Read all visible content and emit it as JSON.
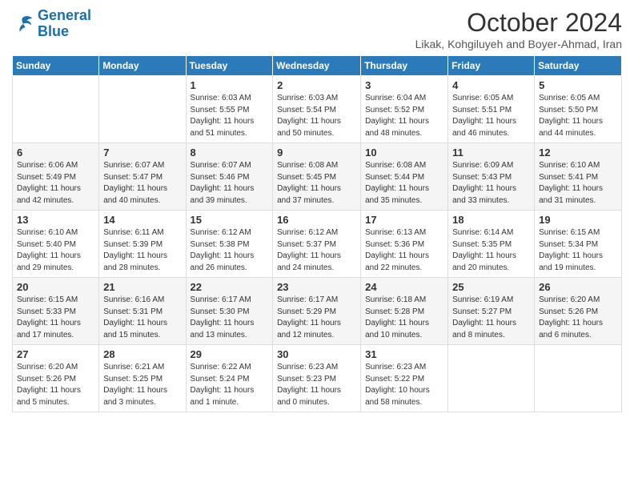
{
  "header": {
    "logo_line1": "General",
    "logo_line2": "Blue",
    "month": "October 2024",
    "location": "Likak, Kohgiluyeh and Boyer-Ahmad, Iran"
  },
  "days_of_week": [
    "Sunday",
    "Monday",
    "Tuesday",
    "Wednesday",
    "Thursday",
    "Friday",
    "Saturday"
  ],
  "weeks": [
    [
      {
        "day": "",
        "info": ""
      },
      {
        "day": "",
        "info": ""
      },
      {
        "day": "1",
        "info": "Sunrise: 6:03 AM\nSunset: 5:55 PM\nDaylight: 11 hours and 51 minutes."
      },
      {
        "day": "2",
        "info": "Sunrise: 6:03 AM\nSunset: 5:54 PM\nDaylight: 11 hours and 50 minutes."
      },
      {
        "day": "3",
        "info": "Sunrise: 6:04 AM\nSunset: 5:52 PM\nDaylight: 11 hours and 48 minutes."
      },
      {
        "day": "4",
        "info": "Sunrise: 6:05 AM\nSunset: 5:51 PM\nDaylight: 11 hours and 46 minutes."
      },
      {
        "day": "5",
        "info": "Sunrise: 6:05 AM\nSunset: 5:50 PM\nDaylight: 11 hours and 44 minutes."
      }
    ],
    [
      {
        "day": "6",
        "info": "Sunrise: 6:06 AM\nSunset: 5:49 PM\nDaylight: 11 hours and 42 minutes."
      },
      {
        "day": "7",
        "info": "Sunrise: 6:07 AM\nSunset: 5:47 PM\nDaylight: 11 hours and 40 minutes."
      },
      {
        "day": "8",
        "info": "Sunrise: 6:07 AM\nSunset: 5:46 PM\nDaylight: 11 hours and 39 minutes."
      },
      {
        "day": "9",
        "info": "Sunrise: 6:08 AM\nSunset: 5:45 PM\nDaylight: 11 hours and 37 minutes."
      },
      {
        "day": "10",
        "info": "Sunrise: 6:08 AM\nSunset: 5:44 PM\nDaylight: 11 hours and 35 minutes."
      },
      {
        "day": "11",
        "info": "Sunrise: 6:09 AM\nSunset: 5:43 PM\nDaylight: 11 hours and 33 minutes."
      },
      {
        "day": "12",
        "info": "Sunrise: 6:10 AM\nSunset: 5:41 PM\nDaylight: 11 hours and 31 minutes."
      }
    ],
    [
      {
        "day": "13",
        "info": "Sunrise: 6:10 AM\nSunset: 5:40 PM\nDaylight: 11 hours and 29 minutes."
      },
      {
        "day": "14",
        "info": "Sunrise: 6:11 AM\nSunset: 5:39 PM\nDaylight: 11 hours and 28 minutes."
      },
      {
        "day": "15",
        "info": "Sunrise: 6:12 AM\nSunset: 5:38 PM\nDaylight: 11 hours and 26 minutes."
      },
      {
        "day": "16",
        "info": "Sunrise: 6:12 AM\nSunset: 5:37 PM\nDaylight: 11 hours and 24 minutes."
      },
      {
        "day": "17",
        "info": "Sunrise: 6:13 AM\nSunset: 5:36 PM\nDaylight: 11 hours and 22 minutes."
      },
      {
        "day": "18",
        "info": "Sunrise: 6:14 AM\nSunset: 5:35 PM\nDaylight: 11 hours and 20 minutes."
      },
      {
        "day": "19",
        "info": "Sunrise: 6:15 AM\nSunset: 5:34 PM\nDaylight: 11 hours and 19 minutes."
      }
    ],
    [
      {
        "day": "20",
        "info": "Sunrise: 6:15 AM\nSunset: 5:33 PM\nDaylight: 11 hours and 17 minutes."
      },
      {
        "day": "21",
        "info": "Sunrise: 6:16 AM\nSunset: 5:31 PM\nDaylight: 11 hours and 15 minutes."
      },
      {
        "day": "22",
        "info": "Sunrise: 6:17 AM\nSunset: 5:30 PM\nDaylight: 11 hours and 13 minutes."
      },
      {
        "day": "23",
        "info": "Sunrise: 6:17 AM\nSunset: 5:29 PM\nDaylight: 11 hours and 12 minutes."
      },
      {
        "day": "24",
        "info": "Sunrise: 6:18 AM\nSunset: 5:28 PM\nDaylight: 11 hours and 10 minutes."
      },
      {
        "day": "25",
        "info": "Sunrise: 6:19 AM\nSunset: 5:27 PM\nDaylight: 11 hours and 8 minutes."
      },
      {
        "day": "26",
        "info": "Sunrise: 6:20 AM\nSunset: 5:26 PM\nDaylight: 11 hours and 6 minutes."
      }
    ],
    [
      {
        "day": "27",
        "info": "Sunrise: 6:20 AM\nSunset: 5:26 PM\nDaylight: 11 hours and 5 minutes."
      },
      {
        "day": "28",
        "info": "Sunrise: 6:21 AM\nSunset: 5:25 PM\nDaylight: 11 hours and 3 minutes."
      },
      {
        "day": "29",
        "info": "Sunrise: 6:22 AM\nSunset: 5:24 PM\nDaylight: 11 hours and 1 minute."
      },
      {
        "day": "30",
        "info": "Sunrise: 6:23 AM\nSunset: 5:23 PM\nDaylight: 11 hours and 0 minutes."
      },
      {
        "day": "31",
        "info": "Sunrise: 6:23 AM\nSunset: 5:22 PM\nDaylight: 10 hours and 58 minutes."
      },
      {
        "day": "",
        "info": ""
      },
      {
        "day": "",
        "info": ""
      }
    ]
  ]
}
